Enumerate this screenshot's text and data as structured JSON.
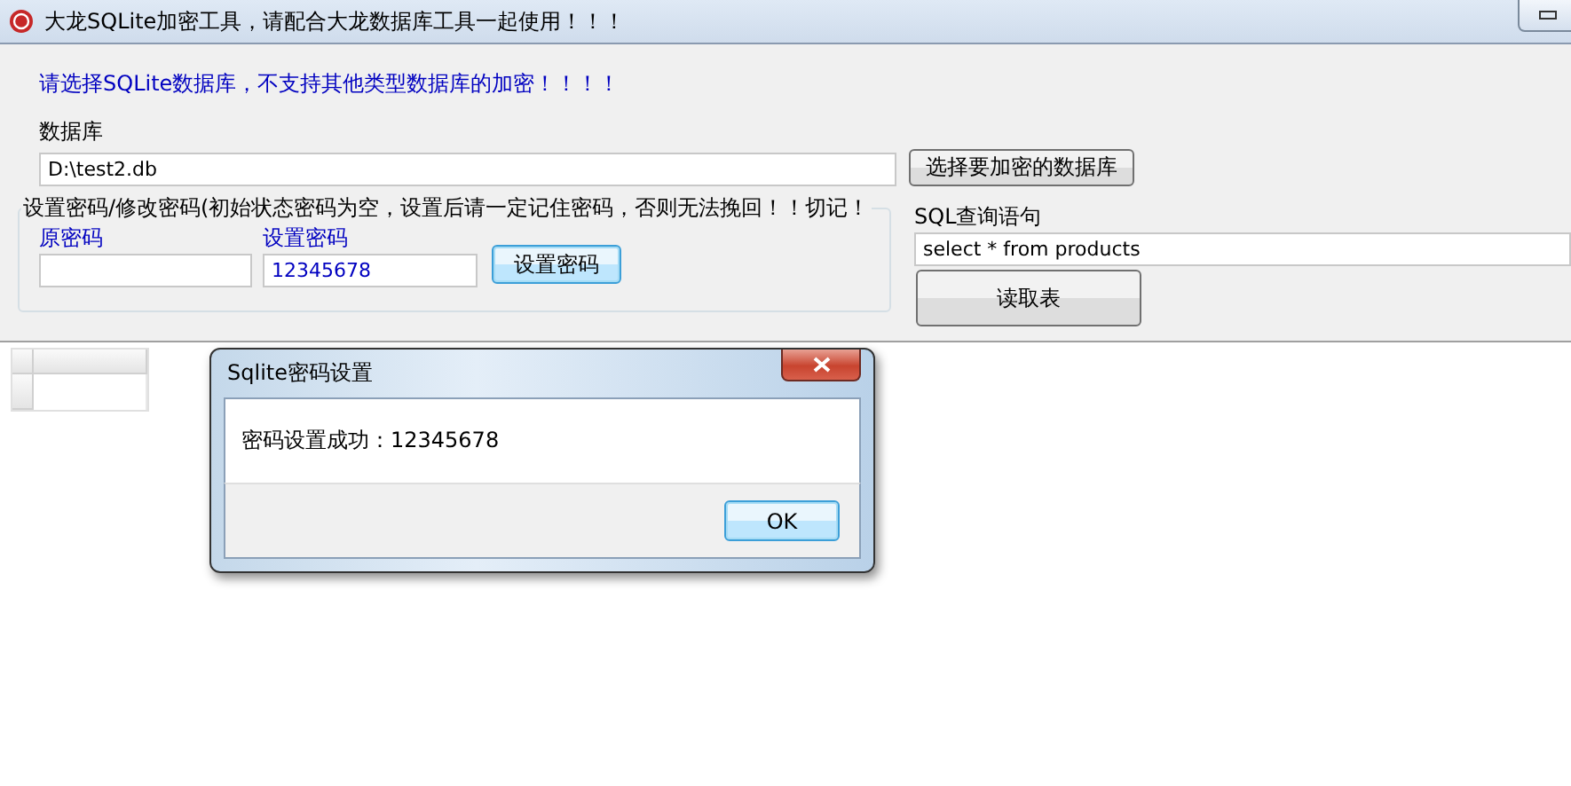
{
  "window": {
    "title": "大龙SQLite加密工具，请配合大龙数据库工具一起使用！！！"
  },
  "notice": "请选择SQLite数据库，不支持其他类型数据库的加密！！！！",
  "database": {
    "label": "数据库",
    "value": "D:\\test2.db",
    "button": "选择要加密的数据库"
  },
  "password_group": {
    "legend": "设置密码/修改密码(初始状态密码为空，设置后请一定记住密码，否则无法挽回！！切记！",
    "old_label": "原密码",
    "new_label": "设置密码",
    "new_value": "12345678",
    "button": "设置密码"
  },
  "sql": {
    "label": "SQL查询语句",
    "value": "select * from products",
    "button": "读取表"
  },
  "dialog": {
    "title": "Sqlite密码设置",
    "message": "密码设置成功：12345678",
    "ok_button": "OK"
  }
}
